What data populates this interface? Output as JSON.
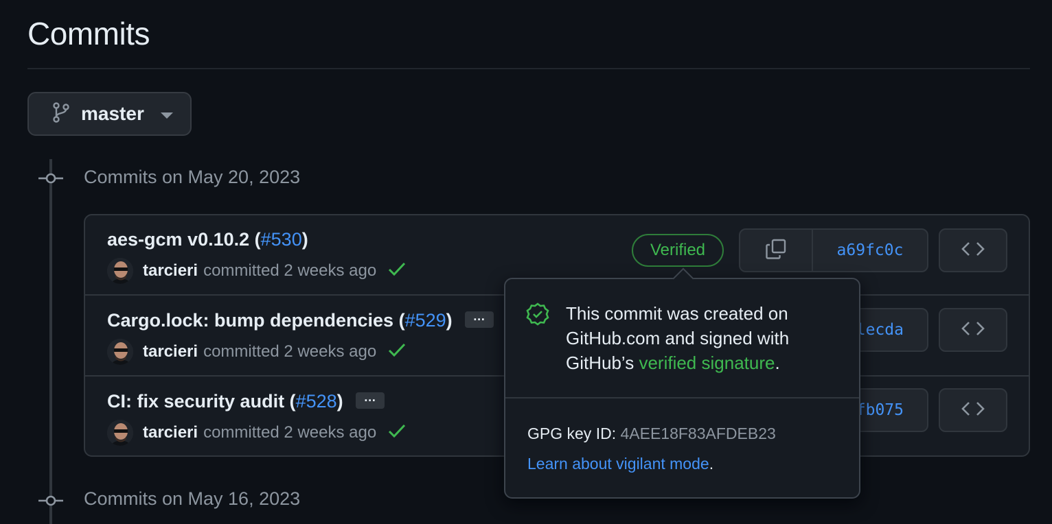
{
  "page": {
    "title": "Commits"
  },
  "branch": {
    "name": "master"
  },
  "groups": [
    {
      "date_label": "Commits on May 20, 2023",
      "commits": [
        {
          "title": "aes-gcm v0.10.2 (",
          "pr": "#530",
          "title_end": ")",
          "author": "tarcieri",
          "meta": "committed 2 weeks ago",
          "verified": "Verified",
          "sha": "a69fc0c"
        },
        {
          "title": "Cargo.lock: bump dependencies (",
          "pr": "#529",
          "title_end": ")",
          "ellipsis": "…",
          "author": "tarcieri",
          "meta": "committed 2 weeks ago",
          "sha": "lecda"
        },
        {
          "title": "CI: fix security audit (",
          "pr": "#528",
          "title_end": ")",
          "ellipsis": "…",
          "author": "tarcieri",
          "meta": "committed 2 weeks ago",
          "sha": "fb075"
        }
      ]
    },
    {
      "date_label": "Commits on May 16, 2023"
    }
  ],
  "popover": {
    "text_before": "This commit was created on GitHub.com and signed with GitHub’s ",
    "text_highlight": "verified signature",
    "text_after": ".",
    "gpg_label": "GPG key ID: ",
    "gpg_value": "4AEE18F83AFDEB23",
    "learn_link": "Learn about vigilant mode",
    "learn_after": "."
  },
  "colors": {
    "background": "#0d1117",
    "link": "#4493f8",
    "success": "#3fb950",
    "muted": "#8d96a0"
  },
  "icons": [
    "git-branch-icon",
    "caret-down-icon",
    "git-commit-icon",
    "check-icon",
    "copy-icon",
    "code-icon",
    "verified-shield-icon"
  ]
}
